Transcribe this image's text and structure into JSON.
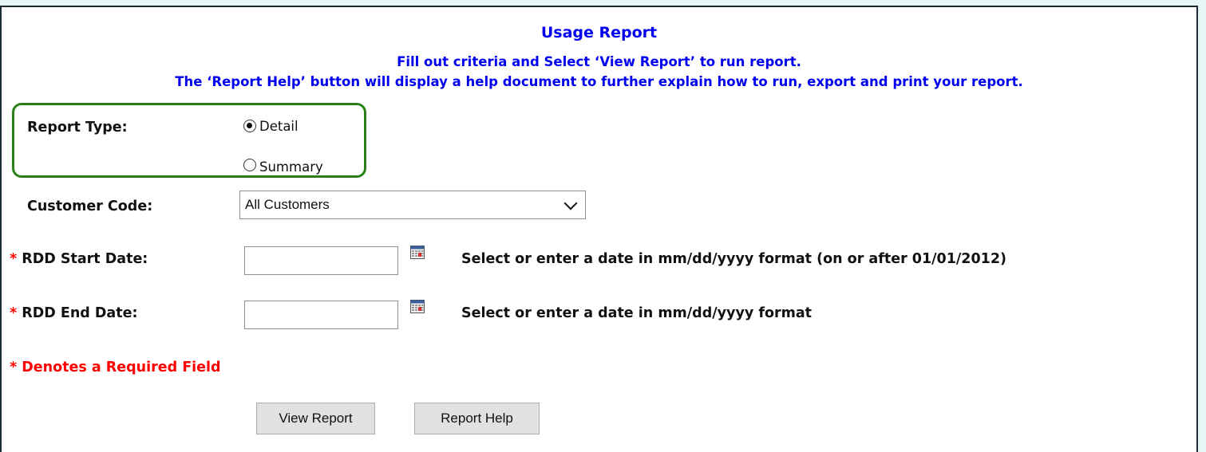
{
  "header": {
    "title": "Usage Report",
    "instruction_line1": "Fill out criteria and Select ‘View Report’ to run report.",
    "instruction_line2": "The ‘Report Help’ button will display a help document to further explain how to run, export and print your report."
  },
  "report_type": {
    "label": "Report Type:",
    "options": [
      {
        "label": "Detail",
        "selected": true
      },
      {
        "label": "Summary",
        "selected": false
      }
    ]
  },
  "customer_code": {
    "label": "Customer Code:",
    "selected_value": "All Customers"
  },
  "start_date": {
    "required_marker": "*",
    "label": "RDD Start Date:",
    "value": "",
    "hint": "Select or enter a date in mm/dd/yyyy format (on or after 01/01/2012)",
    "icon": "calendar-icon"
  },
  "end_date": {
    "required_marker": "*",
    "label": "RDD End Date:",
    "value": "",
    "hint": "Select or enter a date in mm/dd/yyyy format",
    "icon": "calendar-icon"
  },
  "required_note": "* Denotes a Required Field",
  "buttons": {
    "view_report": "View Report",
    "report_help": "Report Help"
  },
  "colors": {
    "title_blue": "#0000ee",
    "required_red": "#ff0000",
    "highlight_green": "#2a7f17"
  }
}
